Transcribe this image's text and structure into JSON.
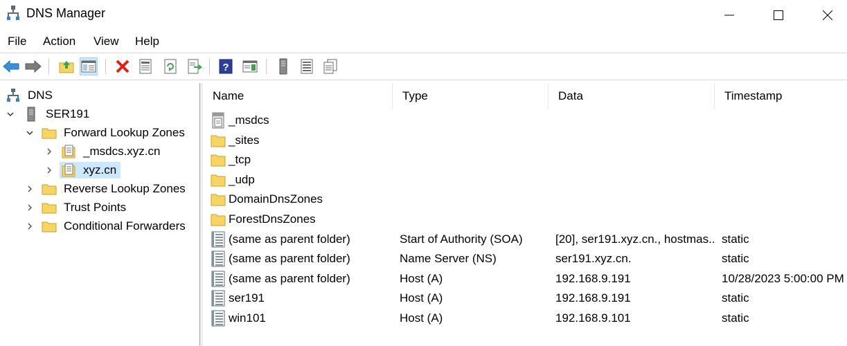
{
  "window": {
    "title": "DNS Manager",
    "minimize": "—",
    "maximize": "☐",
    "close": "✕"
  },
  "menu": [
    "File",
    "Action",
    "View",
    "Help"
  ],
  "toolbar": {
    "icons": [
      "back-icon",
      "forward-icon",
      "up-folder-icon",
      "show-hide-console-tree-icon",
      "delete-icon",
      "properties-icon",
      "refresh-icon",
      "export-list-icon",
      "help-icon",
      "action-pane-icon",
      "server-icon",
      "zone-list-icon",
      "copy-icon"
    ]
  },
  "tree": {
    "root": "DNS",
    "server": "SER191",
    "forward_zones": "Forward Lookup Zones",
    "msdcs_zone": "_msdcs.xyz.cn",
    "xyz_zone": "xyz.cn",
    "reverse_zones": "Reverse Lookup Zones",
    "trust_points": "Trust Points",
    "conditional_forwarders": "Conditional Forwarders"
  },
  "columns": {
    "name": "Name",
    "type": "Type",
    "data": "Data",
    "timestamp": "Timestamp"
  },
  "rows": [
    {
      "name": "_msdcs",
      "icon": "delegated-zone-icon",
      "type": "",
      "data": "",
      "timestamp": ""
    },
    {
      "name": "_sites",
      "icon": "folder-icon",
      "type": "",
      "data": "",
      "timestamp": ""
    },
    {
      "name": "_tcp",
      "icon": "folder-icon",
      "type": "",
      "data": "",
      "timestamp": ""
    },
    {
      "name": "_udp",
      "icon": "folder-icon",
      "type": "",
      "data": "",
      "timestamp": ""
    },
    {
      "name": "DomainDnsZones",
      "icon": "folder-icon",
      "type": "",
      "data": "",
      "timestamp": ""
    },
    {
      "name": "ForestDnsZones",
      "icon": "folder-icon",
      "type": "",
      "data": "",
      "timestamp": ""
    },
    {
      "name": "(same as parent folder)",
      "icon": "record-icon",
      "type": "Start of Authority (SOA)",
      "data": "[20], ser191.xyz.cn., hostmas...",
      "timestamp": "static"
    },
    {
      "name": "(same as parent folder)",
      "icon": "record-icon",
      "type": "Name Server (NS)",
      "data": "ser191.xyz.cn.",
      "timestamp": "static"
    },
    {
      "name": "(same as parent folder)",
      "icon": "record-icon",
      "type": "Host (A)",
      "data": "192.168.9.191",
      "timestamp": "10/28/2023 5:00:00 PM"
    },
    {
      "name": "ser191",
      "icon": "record-icon",
      "type": "Host (A)",
      "data": "192.168.9.191",
      "timestamp": "static"
    },
    {
      "name": "win101",
      "icon": "record-icon",
      "type": "Host (A)",
      "data": "192.168.9.101",
      "timestamp": "static"
    }
  ],
  "colors": {
    "selection": "#cce8ff",
    "folder": "#f6d565",
    "folder_border": "#c9a227"
  }
}
